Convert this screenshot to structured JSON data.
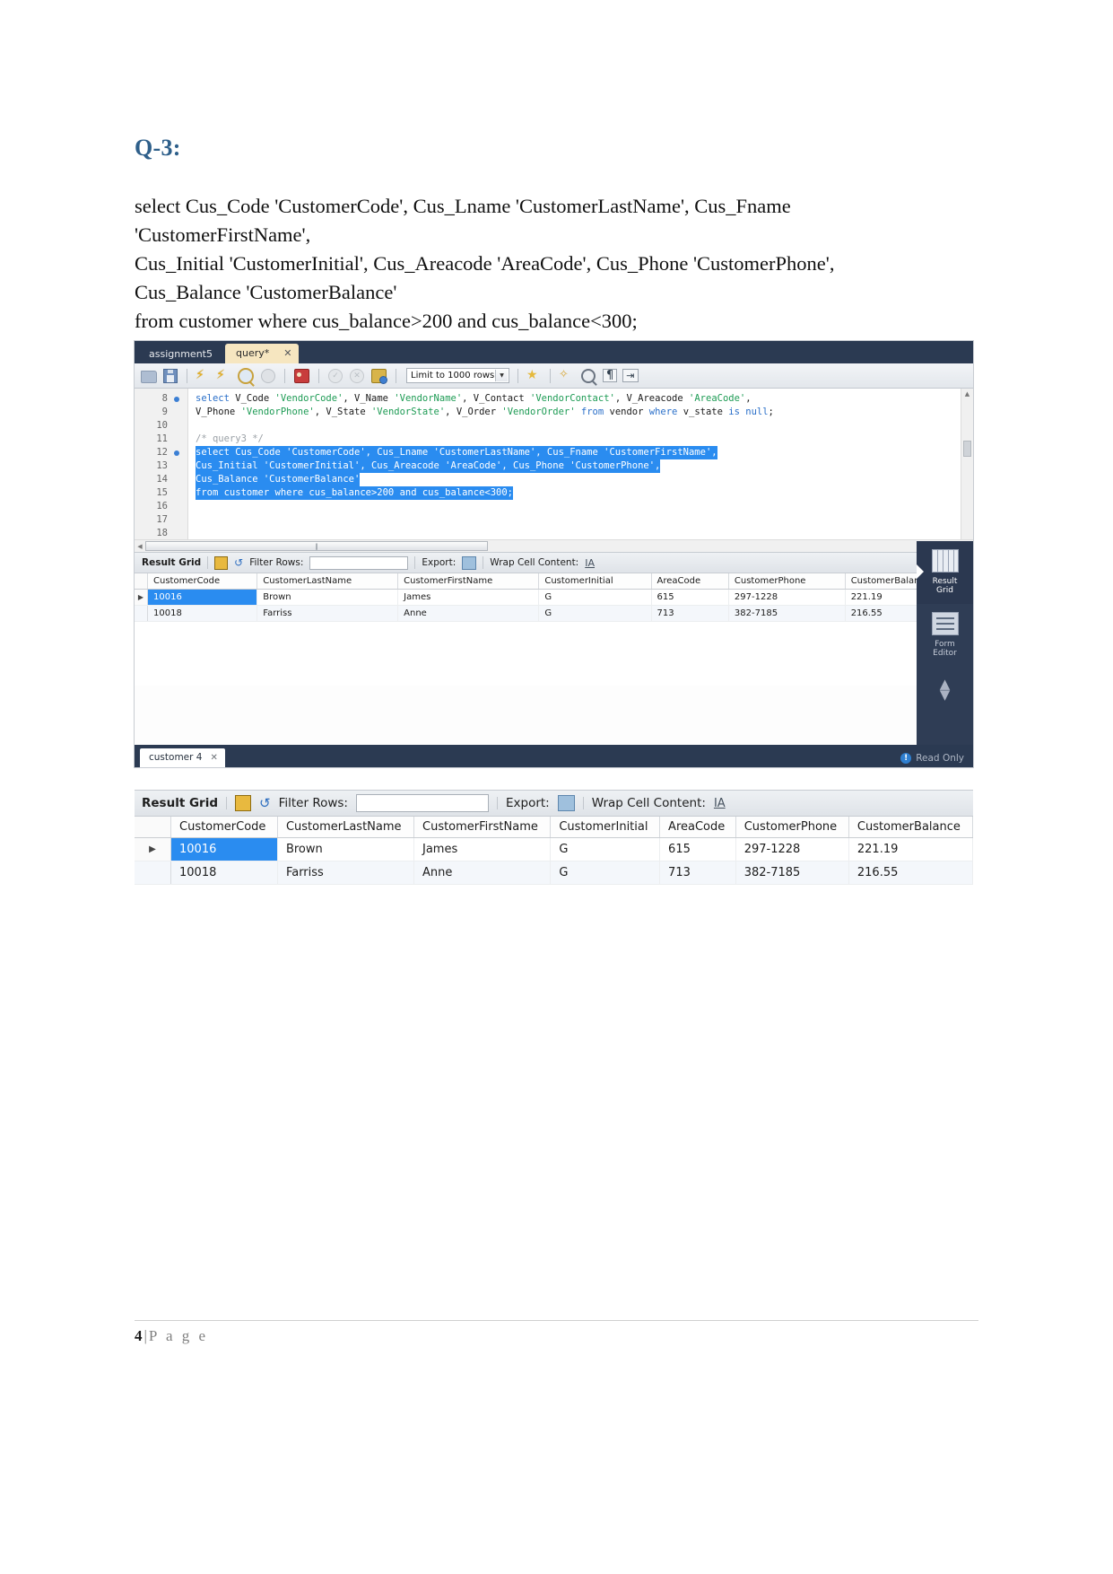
{
  "document": {
    "question_title": "Q-3:",
    "sql_text": "select Cus_Code 'CustomerCode', Cus_Lname 'CustomerLastName', Cus_Fname\n'CustomerFirstName',\nCus_Initial 'CustomerInitial', Cus_Areacode 'AreaCode', Cus_Phone 'CustomerPhone',\nCus_Balance 'CustomerBalance'\nfrom customer where cus_balance>200 and cus_balance<300;"
  },
  "footer": {
    "page_number": "4",
    "separator": "|",
    "page_word": "P a g e"
  },
  "workbench": {
    "tabs": [
      {
        "label": "assignment5",
        "active": false
      },
      {
        "label": "query*",
        "active": true,
        "close": "✕"
      }
    ],
    "toolbar": {
      "icons": [
        "open-folder-icon",
        "save-icon",
        "execute-icon",
        "execute-current-icon",
        "explain-icon",
        "stop-icon",
        "toggle-explain-icon",
        "commit-icon",
        "rollback-icon",
        "autocommit-icon"
      ],
      "limit_label": "Limit to 1000 rows",
      "dropdown_caret": "▼",
      "right_icons": [
        "beautify-icon",
        "clear-icon",
        "find-icon",
        "invisible-chars-icon",
        "wrap-lines-icon"
      ]
    },
    "editor": {
      "line_numbers": [
        "8",
        "9",
        "10",
        "11",
        "12",
        "13",
        "14",
        "15",
        "16",
        "17",
        "18"
      ],
      "markers": [
        8,
        12
      ],
      "lines": [
        {
          "n": 8,
          "selected": false,
          "tokens": [
            {
              "t": "select ",
              "c": "kw"
            },
            {
              "t": "V_Code ",
              "c": ""
            },
            {
              "t": "'VendorCode'",
              "c": "str"
            },
            {
              "t": ", V_Name ",
              "c": ""
            },
            {
              "t": "'VendorName'",
              "c": "str"
            },
            {
              "t": ", V_Contact ",
              "c": ""
            },
            {
              "t": "'VendorContact'",
              "c": "str"
            },
            {
              "t": ", V_Areacode ",
              "c": ""
            },
            {
              "t": "'AreaCode'",
              "c": "str"
            },
            {
              "t": ",",
              "c": ""
            }
          ]
        },
        {
          "n": 9,
          "selected": false,
          "tokens": [
            {
              "t": "V_Phone ",
              "c": ""
            },
            {
              "t": "'VendorPhone'",
              "c": "str"
            },
            {
              "t": ", V_State ",
              "c": ""
            },
            {
              "t": "'VendorState'",
              "c": "str"
            },
            {
              "t": ", V_Order ",
              "c": ""
            },
            {
              "t": "'VendorOrder'",
              "c": "str"
            },
            {
              "t": " from",
              "c": "kw"
            },
            {
              "t": " vendor ",
              "c": ""
            },
            {
              "t": "where",
              "c": "kw"
            },
            {
              "t": " v_state ",
              "c": ""
            },
            {
              "t": "is null",
              "c": "kw"
            },
            {
              "t": ";",
              "c": ""
            }
          ]
        },
        {
          "n": 10,
          "selected": false,
          "tokens": []
        },
        {
          "n": 11,
          "selected": false,
          "tokens": [
            {
              "t": "/* query3 */",
              "c": "cmt"
            }
          ]
        },
        {
          "n": 12,
          "selected": true,
          "tokens": [
            {
              "t": "select Cus_Code 'CustomerCode', Cus_Lname 'CustomerLastName', Cus_Fname 'CustomerFirstName',",
              "c": ""
            }
          ]
        },
        {
          "n": 13,
          "selected": true,
          "tokens": [
            {
              "t": "Cus_Initial 'CustomerInitial', Cus_Areacode 'AreaCode', Cus_Phone 'CustomerPhone',",
              "c": ""
            }
          ]
        },
        {
          "n": 14,
          "selected": true,
          "tokens": [
            {
              "t": "Cus_Balance 'CustomerBalance'",
              "c": ""
            }
          ]
        },
        {
          "n": 15,
          "selected": true,
          "tokens": [
            {
              "t": "from customer where cus_balance>200 and cus_balance<300;",
              "c": ""
            }
          ]
        },
        {
          "n": 16,
          "selected": false,
          "tokens": []
        },
        {
          "n": 17,
          "selected": false,
          "tokens": []
        },
        {
          "n": 18,
          "selected": false,
          "tokens": []
        }
      ],
      "scroll_up": "▲",
      "scroll_down": "▼",
      "scroll_left": "◀",
      "scroll_right": "▶",
      "hthumb_grip": "‖"
    },
    "result_toolbar": {
      "title": "Result Grid",
      "filter_label": "Filter Rows:",
      "filter_value": "",
      "filter_placeholder": "",
      "export_label": "Export:",
      "wrap_label": "Wrap Cell Content:",
      "wrap_icon_glyph": "IA"
    },
    "result_grid": {
      "columns": [
        "CustomerCode",
        "CustomerLastName",
        "CustomerFirstName",
        "CustomerInitial",
        "AreaCode",
        "CustomerPhone",
        "CustomerBalance"
      ],
      "rows": [
        {
          "marker": "▶",
          "selected_cell": 0,
          "cells": [
            "10016",
            "Brown",
            "James",
            "G",
            "615",
            "297-1228",
            "221.19"
          ]
        },
        {
          "marker": "",
          "selected_cell": -1,
          "cells": [
            "10018",
            "Farriss",
            "Anne",
            "G",
            "713",
            "382-7185",
            "216.55"
          ]
        }
      ]
    },
    "side_panel": {
      "items": [
        {
          "label": "Result\nGrid",
          "label_line1": "Result",
          "label_line2": "Grid",
          "active": true
        },
        {
          "label": "Form\nEditor",
          "label_line1": "Form",
          "label_line2": "Editor",
          "active": false
        }
      ],
      "chevrons": "◇"
    },
    "status_bar": {
      "result_tab": "customer 4",
      "result_tab_close": "✕",
      "read_only": "Read Only",
      "info_glyph": "!"
    }
  },
  "workbench_zoom": {
    "result_toolbar": {
      "title": "Result Grid",
      "filter_label": "Filter Rows:",
      "filter_value": "",
      "export_label": "Export:",
      "wrap_label": "Wrap Cell Content:"
    },
    "result_grid": {
      "columns": [
        "CustomerCode",
        "CustomerLastName",
        "CustomerFirstName",
        "CustomerInitial",
        "AreaCode",
        "CustomerPhone",
        "CustomerBalance"
      ],
      "rows": [
        {
          "marker": "▶",
          "selected_cell": 0,
          "cells": [
            "10016",
            "Brown",
            "James",
            "G",
            "615",
            "297-1228",
            "221.19"
          ]
        },
        {
          "marker": "",
          "selected_cell": -1,
          "cells": [
            "10018",
            "Farriss",
            "Anne",
            "G",
            "713",
            "382-7185",
            "216.55"
          ]
        }
      ]
    }
  },
  "colors": {
    "heading": "#2e5f8a",
    "selection": "#2a8cf0",
    "titlebar": "#2b3a52",
    "sidepanel": "#2f3d55",
    "keyword": "#2a6fc9",
    "string": "#1d9b54",
    "comment": "#9aa0a6"
  }
}
